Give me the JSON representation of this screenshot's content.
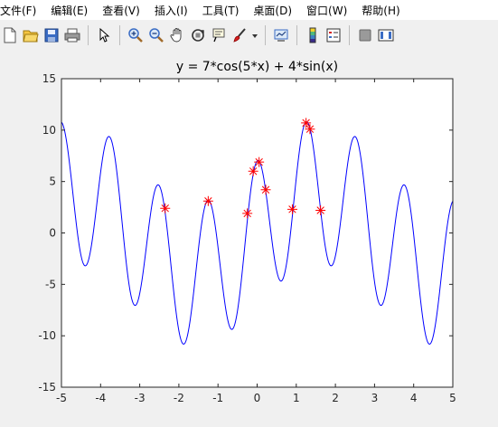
{
  "menu": {
    "items": [
      {
        "label": "文件(F)"
      },
      {
        "label": "编辑(E)"
      },
      {
        "label": "查看(V)"
      },
      {
        "label": "插入(I)"
      },
      {
        "label": "工具(T)"
      },
      {
        "label": "桌面(D)"
      },
      {
        "label": "窗口(W)"
      },
      {
        "label": "帮助(H)"
      }
    ]
  },
  "toolbar": {
    "buttons": [
      {
        "icon": "new-figure-icon"
      },
      {
        "icon": "open-file-icon"
      },
      {
        "icon": "save-icon"
      },
      {
        "icon": "print-icon"
      },
      {
        "icon": "edit-plot-arrow-icon"
      },
      {
        "icon": "zoom-in-icon"
      },
      {
        "icon": "zoom-out-icon"
      },
      {
        "icon": "pan-hand-icon"
      },
      {
        "icon": "rotate-3d-icon"
      },
      {
        "icon": "data-cursor-icon"
      },
      {
        "icon": "brush-icon"
      },
      {
        "icon": "brush-dropdown-icon"
      },
      {
        "icon": "link-plot-icon"
      },
      {
        "icon": "insert-colorbar-icon"
      },
      {
        "icon": "insert-legend-icon"
      },
      {
        "icon": "hide-plot-tools-icon"
      },
      {
        "icon": "show-plot-tools-icon"
      }
    ]
  },
  "colors": {
    "curve": "#0000ff",
    "markers": "#ff0000",
    "axes_bg": "#ffffff",
    "figure_bg": "#f0f0f0"
  },
  "chart_data": {
    "type": "line",
    "title": "y = 7*cos(5*x) + 4*sin(x)",
    "function": "7*cos(5*x) + 4*sin(x)",
    "xlim": [
      -5,
      5
    ],
    "ylim": [
      -15,
      15
    ],
    "xticks": [
      -5,
      -4,
      -3,
      -2,
      -1,
      0,
      1,
      2,
      3,
      4,
      5
    ],
    "yticks": [
      -15,
      -10,
      -5,
      0,
      5,
      10,
      15
    ],
    "grid": false,
    "series": [
      {
        "style": "line"
      },
      {
        "style": "star-markers",
        "points": [
          [
            -2.35,
            2.4
          ],
          [
            -1.25,
            3.1
          ],
          [
            -0.25,
            1.9
          ],
          [
            -0.1,
            6.0
          ],
          [
            0.05,
            6.9
          ],
          [
            0.22,
            4.2
          ],
          [
            0.9,
            2.3
          ],
          [
            1.25,
            10.7
          ],
          [
            1.35,
            10.1
          ],
          [
            1.62,
            2.2
          ]
        ]
      }
    ]
  }
}
